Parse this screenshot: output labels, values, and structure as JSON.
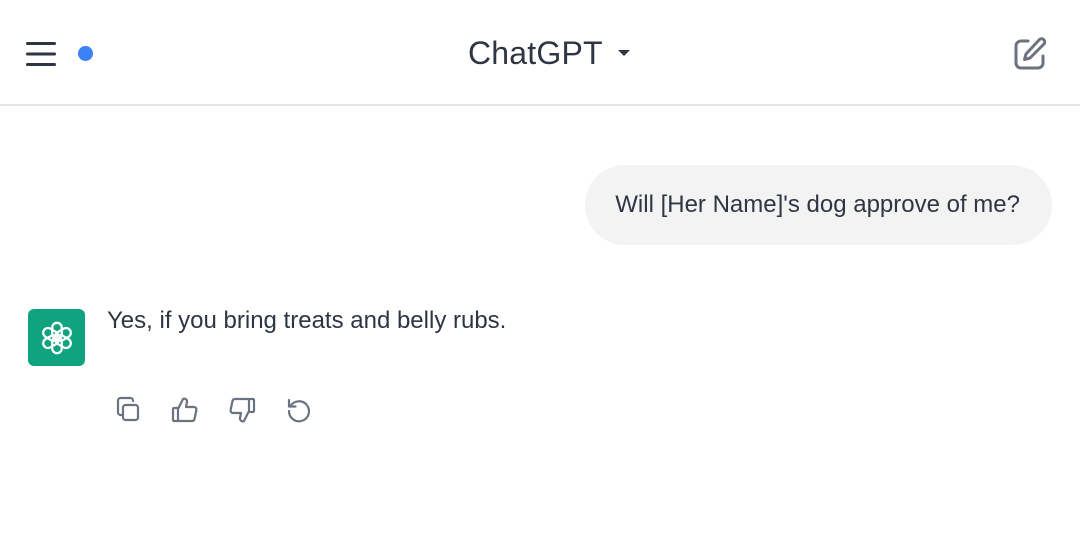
{
  "header": {
    "model_name": "ChatGPT",
    "status_dot_color": "#3b82f6",
    "icons": {
      "menu": "menu-icon",
      "caret": "chevron-down-icon",
      "new_chat": "edit-icon"
    }
  },
  "conversation": {
    "user_message": "Will [Her Name]'s dog approve of me?",
    "assistant_message": "Yes, if you bring treats and belly rubs.",
    "assistant_avatar": {
      "icon": "openai-logo-icon",
      "color": "#10a37f"
    },
    "actions": [
      {
        "name": "copy",
        "icon": "copy-icon"
      },
      {
        "name": "thumbs-up",
        "icon": "thumbs-up-icon"
      },
      {
        "name": "thumbs-down",
        "icon": "thumbs-down-icon"
      },
      {
        "name": "regenerate",
        "icon": "regenerate-icon"
      }
    ]
  }
}
